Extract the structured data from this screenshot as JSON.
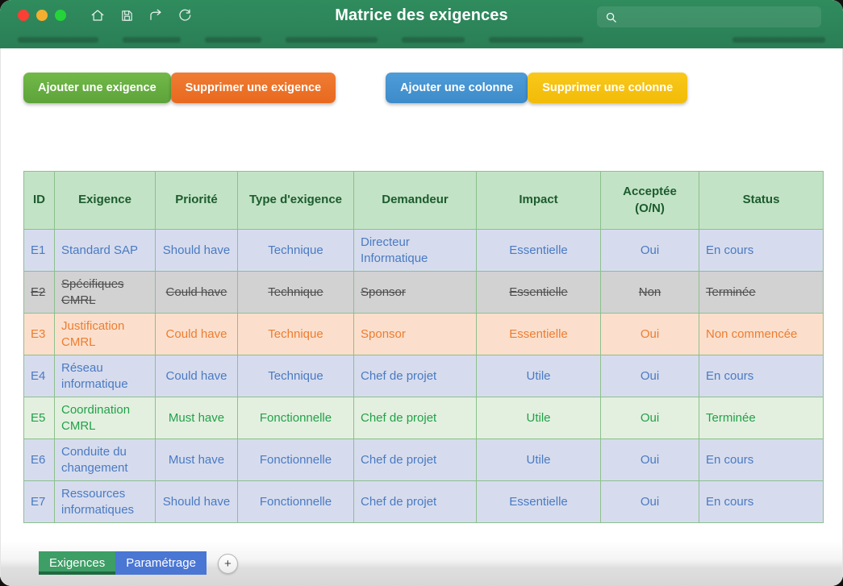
{
  "window": {
    "title": "Matrice des exigences",
    "traffic_lights": [
      "close",
      "minimize",
      "maximize"
    ],
    "toolbar_icons": [
      "home-icon",
      "save-icon",
      "redo-icon",
      "refresh-icon"
    ],
    "search": {
      "value": "",
      "placeholder": "",
      "icon": "search-icon"
    }
  },
  "actions": {
    "add_requirement": "Ajouter une exigence",
    "delete_requirement": "Supprimer une exigence",
    "add_column": "Ajouter une colonne",
    "delete_column": "Supprimer une colonne",
    "colors": {
      "add_requirement": "#5da33a",
      "delete_requirement": "#e8691f",
      "add_column": "#3d8bc9",
      "delete_column": "#f2bb08"
    }
  },
  "table": {
    "headers": [
      "ID",
      "Exigence",
      "Priorité",
      "Type d'exigence",
      "Demandeur",
      "Impact",
      "Acceptée (O/N)",
      "Status"
    ],
    "header_accepted_line1": "Acceptée",
    "header_accepted_line2": "(O/N)",
    "header_bg": "#c3e3c6",
    "header_fg": "#1c5c2e",
    "rows": [
      {
        "id": "E1",
        "exigence": "Standard SAP",
        "priorite": "Should have",
        "type": "Technique",
        "demandeur": "Directeur Informatique",
        "impact": "Essentielle",
        "acceptee": "Oui",
        "status": "En cours",
        "theme": "blue",
        "struck": false
      },
      {
        "id": "E2",
        "exigence": "Spécifiques CMRL",
        "priorite": "Could have",
        "type": "Technique",
        "demandeur": "Sponsor",
        "impact": "Essentielle",
        "acceptee": "Non",
        "status": "Terminée",
        "theme": "gray",
        "struck": true
      },
      {
        "id": "E3",
        "exigence": "Justification CMRL",
        "priorite": "Could have",
        "type": "Technique",
        "demandeur": "Sponsor",
        "impact": "Essentielle",
        "acceptee": "Oui",
        "status": "Non commencée",
        "theme": "peach",
        "struck": false
      },
      {
        "id": "E4",
        "exigence": "Réseau informatique",
        "priorite": "Could have",
        "type": "Technique",
        "demandeur": "Chef de projet",
        "impact": "Utile",
        "acceptee": "Oui",
        "status": "En cours",
        "theme": "blue",
        "struck": false
      },
      {
        "id": "E5",
        "exigence": "Coordination CMRL",
        "priorite": "Must have",
        "type": "Fonctionnelle",
        "demandeur": "Chef de projet",
        "impact": "Utile",
        "acceptee": "Oui",
        "status": "Terminée",
        "theme": "green",
        "struck": false
      },
      {
        "id": "E6",
        "exigence": "Conduite du changement",
        "priorite": "Must have",
        "type": "Fonctionnelle",
        "demandeur": "Chef de projet",
        "impact": "Utile",
        "acceptee": "Oui",
        "status": "En cours",
        "theme": "blue",
        "struck": false
      },
      {
        "id": "E7",
        "exigence": "Ressources informatiques",
        "priorite": "Should have",
        "type": "Fonctionnelle",
        "demandeur": "Chef de projet",
        "impact": "Essentielle",
        "acceptee": "Oui",
        "status": "En cours",
        "theme": "blue",
        "struck": false
      }
    ],
    "row_colors": {
      "blue_bg": "#d6dcee",
      "blue_fg": "#4a7ac2",
      "gray_bg": "#d2d2d2",
      "gray_fg": "#4f4f4f",
      "peach_bg": "#fbdfcc",
      "peach_fg": "#ed7d31",
      "green_bg": "#e3f0df",
      "green_fg": "#22a14a"
    }
  },
  "sheets": {
    "tabs": [
      {
        "label": "Exigences",
        "active": true
      },
      {
        "label": "Paramétrage",
        "active": false
      }
    ],
    "add_label": "+"
  }
}
